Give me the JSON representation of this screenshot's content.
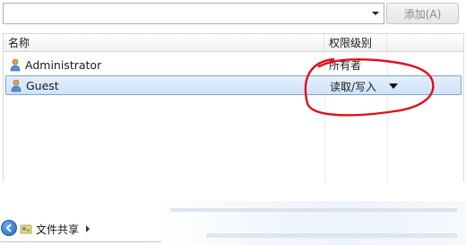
{
  "add_button": {
    "label": "添加(A)",
    "state": "disabled"
  },
  "table": {
    "columns": [
      "名称",
      "权限级别"
    ],
    "rows": [
      {
        "name": "Administrator",
        "permission": "所有者",
        "selected": false
      },
      {
        "name": "Guest",
        "permission": "读取/写入",
        "selected": true,
        "has_dropdown": true
      }
    ]
  },
  "annotation": {
    "color": "#e0101a",
    "shape": "hand-drawn circle around permission column"
  },
  "breadcrumb": {
    "items": [
      "文件共享"
    ]
  },
  "icons": {
    "user": "user-icon",
    "dropdown": "dropdown-arrow-icon",
    "back": "back-arrow-icon",
    "folder": "file-sharing-icon"
  },
  "colors": {
    "selection_bg": "#cfe3f7",
    "selection_border": "#7da2ce",
    "annotation": "#e0101a"
  }
}
